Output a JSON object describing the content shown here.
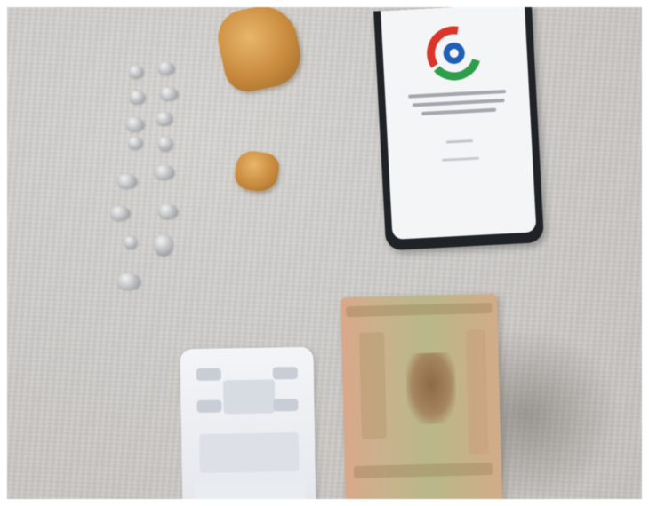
{
  "photo": {
    "subject_items": [
      "small-foil-packets",
      "amber-rock-pieces",
      "smartphone",
      "pocket-scale",
      "banknote-stack"
    ],
    "colors": {
      "surface": "#cfcdca",
      "phone_body": "#1f2226",
      "rock": "#c98b3e",
      "logo_red": "#d9352b",
      "logo_blue": "#1f5fb8",
      "logo_green": "#2f9e4a"
    },
    "icons": {
      "phone_logo": "circular-app-logo-icon"
    }
  }
}
